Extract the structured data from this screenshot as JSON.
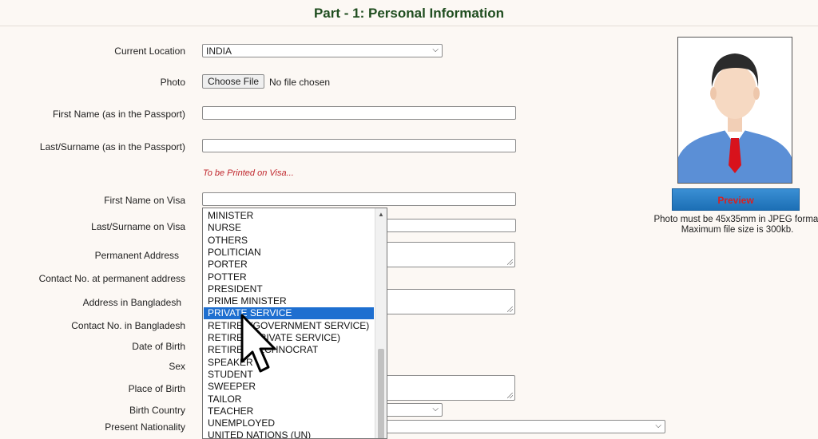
{
  "header": {
    "title": "Part - 1: Personal Information"
  },
  "form": {
    "current_location_label": "Current Location",
    "current_location_value": "INDIA",
    "photo_label": "Photo",
    "choose_file_label": "Choose File",
    "no_file_text": "No file chosen",
    "first_name_passport_label": "First Name (as in the Passport)",
    "last_name_passport_label": "Last/Surname (as in the Passport)",
    "print_note": "To be Printed on Visa...",
    "first_name_visa_label": "First Name on Visa",
    "last_name_visa_label": "Last/Surname on Visa",
    "permanent_address_label": "Permanent Address",
    "contact_permanent_label": "Contact No. at permanent address",
    "address_bd_label": "Address in Bangladesh",
    "contact_bd_label": "Contact No. in Bangladesh",
    "dob_label": "Date of Birth",
    "sex_label": "Sex",
    "place_of_birth_label": "Place of Birth",
    "birth_country_label": "Birth Country",
    "present_nationality_label": "Present Nationality"
  },
  "photo_panel": {
    "preview_label": "Preview",
    "note_line1": "Photo must be 45x35mm in JPEG format",
    "note_line2": "Maximum file size is 300kb."
  },
  "occupation_dropdown": {
    "options": [
      "MINISTER",
      "NURSE",
      "OTHERS",
      "POLITICIAN",
      "PORTER",
      "POTTER",
      "PRESIDENT",
      "PRIME MINISTER",
      "PRIVATE SERVICE",
      "RETIRED(GOVERNMENT SERVICE)",
      "RETIRED(PRIVATE SERVICE)",
      "RETIRED TECHNOCRAT",
      "SPEAKER",
      "STUDENT",
      "SWEEPER",
      "TAILOR",
      "TEACHER",
      "UNEMPLOYED",
      "UNITED NATIONS (UN)"
    ],
    "selected_index": 8
  },
  "colors": {
    "title": "#1f4d1f",
    "selected_option": "#1e6fd0",
    "print_note": "#c0272d",
    "preview_button": "#1c6fb5"
  }
}
